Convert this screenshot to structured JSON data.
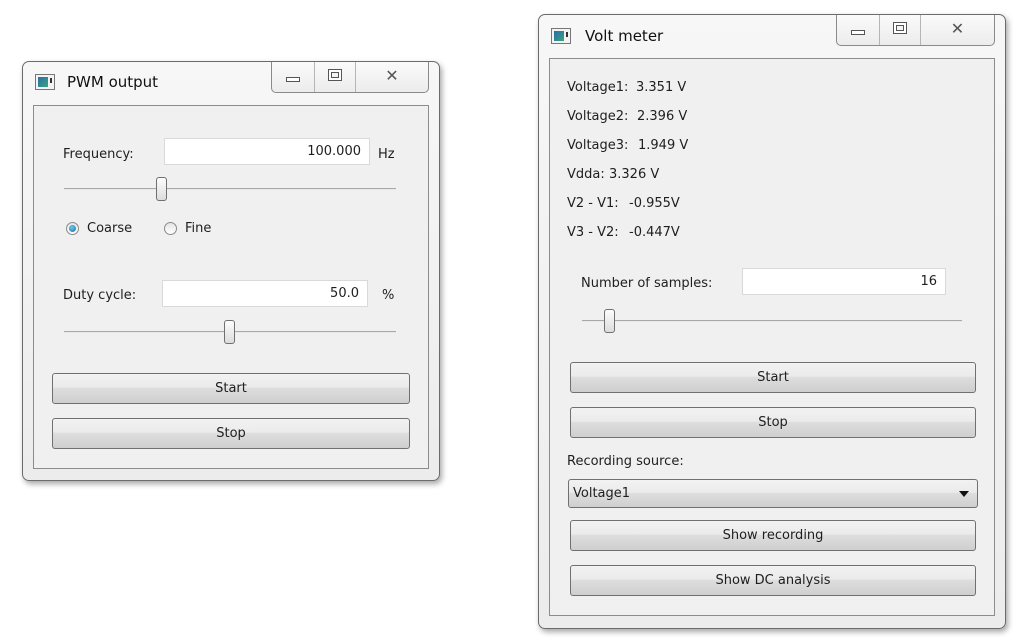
{
  "pwm_window": {
    "title": "PWM output",
    "icon": "app-window-icon",
    "controls": {
      "minimize": "minimize-icon",
      "maximize": "maximize-icon",
      "close": "✕"
    },
    "frequency": {
      "label": "Frequency:",
      "value": "100.000",
      "unit": "Hz",
      "slider_fraction": 0.3
    },
    "mode": {
      "options": [
        {
          "label": "Coarse",
          "selected": true
        },
        {
          "label": "Fine",
          "selected": false
        }
      ]
    },
    "duty_cycle": {
      "label": "Duty cycle:",
      "value": "50.0",
      "unit": "%",
      "slider_fraction": 0.5
    },
    "start_label": "Start",
    "stop_label": "Stop"
  },
  "volt_window": {
    "title": "Volt meter",
    "icon": "app-window-icon",
    "controls": {
      "minimize": "minimize-icon",
      "maximize": "maximize-icon",
      "close": "✕"
    },
    "readings": [
      {
        "label": "Voltage1:",
        "value": "3.351 V"
      },
      {
        "label": "Voltage2:",
        "value": "2.396 V"
      },
      {
        "label": "Voltage3:",
        "value": "1.949 V"
      },
      {
        "label": "Vdda:",
        "value": "3.326 V"
      },
      {
        "label": "V2 - V1:",
        "value": "-0.955V"
      },
      {
        "label": "V3 - V2:",
        "value": "-0.447V"
      }
    ],
    "samples": {
      "label": "Number of samples:",
      "value": "16",
      "slider_fraction": 0.07
    },
    "start_label": "Start",
    "stop_label": "Stop",
    "recording_source": {
      "label": "Recording source:",
      "selected": "Voltage1"
    },
    "show_recording_label": "Show recording",
    "show_dc_label": "Show DC analysis"
  }
}
